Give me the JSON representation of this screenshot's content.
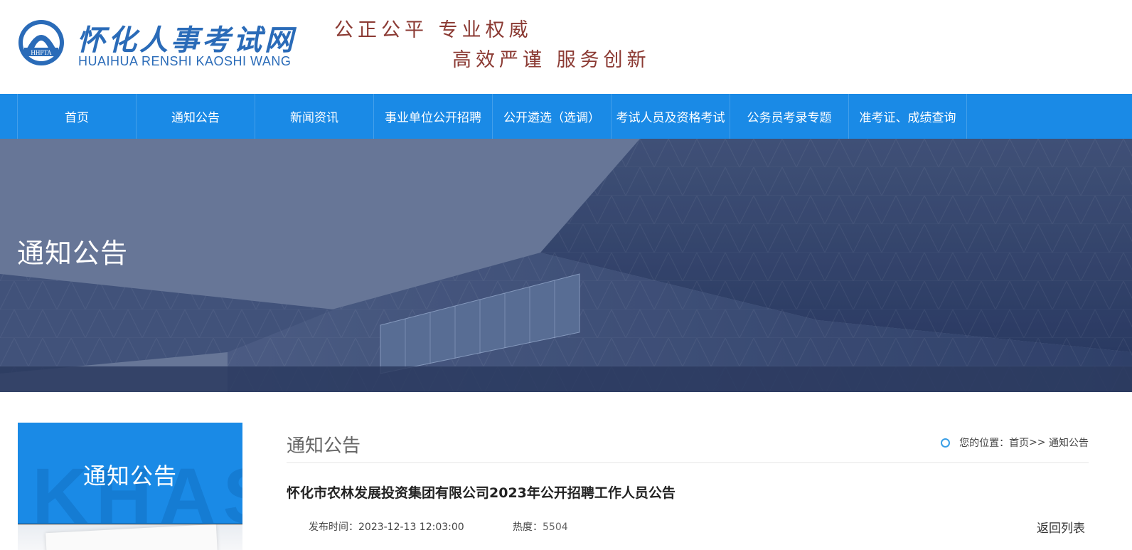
{
  "header": {
    "logo_cn": "怀化人事考试网",
    "logo_en": "HUAIHUA RENSHI KAOSHI WANG",
    "logo_badge": "HHPTA",
    "slogan_line1": "公正公平  专业权威",
    "slogan_line2": "高效严谨  服务创新"
  },
  "nav": {
    "items": [
      {
        "label": "首页"
      },
      {
        "label": "通知公告"
      },
      {
        "label": "新闻资讯"
      },
      {
        "label": "事业单位公开招聘"
      },
      {
        "label": "公开遴选（选调）"
      },
      {
        "label": "考试人员及资格考试"
      },
      {
        "label": "公务员考录专题"
      },
      {
        "label": "准考证、成绩查询"
      }
    ]
  },
  "banner": {
    "title": "通知公告"
  },
  "sidebar": {
    "title": "通知公告",
    "watermark": "KHAS"
  },
  "main": {
    "section_title": "通知公告",
    "breadcrumb": {
      "prefix": "您的位置：",
      "home": "首页",
      "separator": ">>",
      "current": "通知公告"
    },
    "article": {
      "title": "怀化市农林发展投资集团有限公司2023年公开招聘工作人员公告",
      "publish_label": "发布时间：",
      "publish_time": "2023-12-13 12:03:00",
      "heat_label": "热度：",
      "heat_value": "5504",
      "back_label": "返回列表"
    }
  },
  "colors": {
    "nav_bg": "#1a8ae6",
    "logo_blue": "#2a6bb8",
    "slogan_red": "#8b3a33"
  }
}
